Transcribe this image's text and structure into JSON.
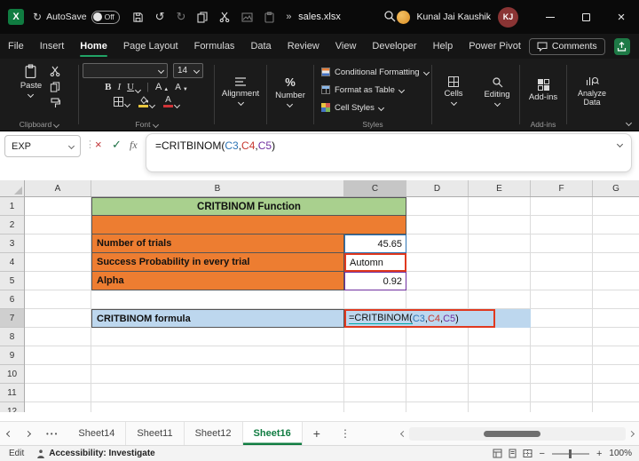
{
  "titlebar": {
    "autosave_label": "AutoSave",
    "autosave_state": "Off",
    "overflow": "»",
    "filename": "sales.xlsx",
    "user_name": "Kunal Jai Kaushik",
    "user_initials": "KJ"
  },
  "menubar": {
    "items": [
      "File",
      "Insert",
      "Home",
      "Page Layout",
      "Formulas",
      "Data",
      "Review",
      "View",
      "Developer",
      "Help",
      "Power Pivot"
    ],
    "active_item": "Home",
    "comments_label": "Comments"
  },
  "ribbon": {
    "paste": "Paste",
    "font_name": "",
    "font_size": "14",
    "bold": "B",
    "italic": "I",
    "underline": "U",
    "grow_font": "A",
    "shrink_font": "A",
    "font_color_letter": "A",
    "alignment": "Alignment",
    "number": "Number",
    "conditional_formatting": "Conditional Formatting",
    "format_as_table": "Format as Table",
    "cell_styles": "Cell Styles",
    "cells": "Cells",
    "editing": "Editing",
    "addins": "Add-ins",
    "analyze_data": "Analyze Data",
    "groups": {
      "clipboard": "Clipboard",
      "font": "Font",
      "styles": "Styles",
      "addins": "Add-ins"
    }
  },
  "formula_bar": {
    "name_box": "EXP",
    "fx": "fx"
  },
  "formula": {
    "full": "=CRITBINOM(C3,C4,C5)",
    "prefix": "=CRITBINOM(",
    "ref1": "C3",
    "sep1": ",",
    "ref2": "C4",
    "sep2": ",",
    "ref3": "C5",
    "close": ")",
    "colors": {
      "ref1": "#2E75B6",
      "ref2": "#C7372F",
      "ref3": "#7030A0"
    }
  },
  "grid": {
    "columns": [
      "A",
      "B",
      "C",
      "D",
      "E",
      "F",
      "G"
    ],
    "rows": [
      "1",
      "2",
      "3",
      "4",
      "5",
      "6",
      "7",
      "8",
      "9",
      "10",
      "11",
      "12"
    ],
    "cells": {
      "b1": "CRITBINOM Function",
      "b3": "Number of trials",
      "c3": "45.65",
      "b4": "Success Probability in every trial",
      "c4": "Automn",
      "b5": "Alpha",
      "c5": "0.92",
      "b7": "CRITBINOM formula"
    },
    "colors": {
      "title_green": "#A9D08E",
      "label_orange": "#ED7D31",
      "formula_blue": "#BDD7EE",
      "annotation_red": "#E0391F"
    }
  },
  "sheet_tabs": {
    "tabs": [
      "Sheet14",
      "Sheet11",
      "Sheet12",
      "Sheet16"
    ],
    "active_tab": "Sheet16"
  },
  "status_bar": {
    "mode": "Edit",
    "accessibility": "Accessibility: Investigate",
    "zoom": "100%"
  }
}
